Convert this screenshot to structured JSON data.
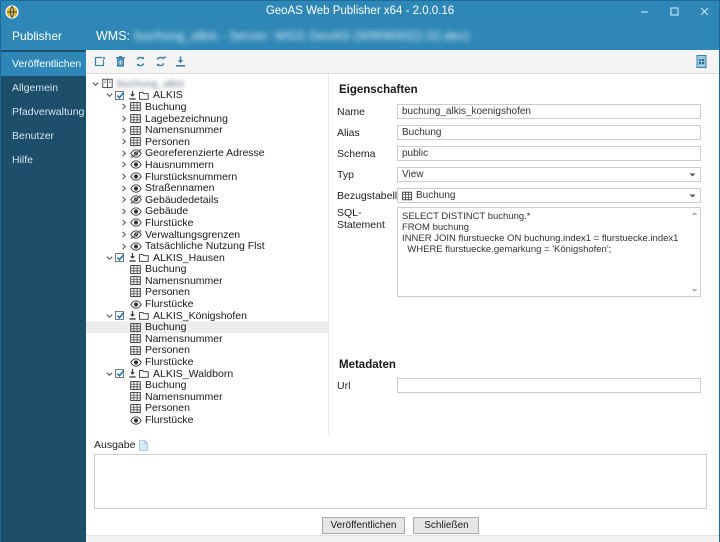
{
  "window": {
    "title": "GeoAS Web Publisher x64 - 2.0.0.16",
    "app_icon": "globe-icon",
    "minimize": "–",
    "maximize": "□",
    "close": "✕"
  },
  "sidebar": {
    "brand": "Publisher",
    "items": [
      {
        "label": "Veröffentlichen",
        "selected": true
      },
      {
        "label": "Allgemein",
        "selected": false
      },
      {
        "label": "Pfadverwaltung",
        "selected": false
      },
      {
        "label": "Benutzer",
        "selected": false
      },
      {
        "label": "Hilfe",
        "selected": false
      }
    ]
  },
  "wms_header": {
    "prefix": "WMS:",
    "value": "buchung_alkis - Server: WGS GeoAS (WWW0022.02.dev)"
  },
  "toolbar": {
    "buttons": [
      {
        "name": "new-icon",
        "title": "Neu"
      },
      {
        "name": "delete-icon",
        "title": "Löschen"
      },
      {
        "name": "refresh-icon",
        "title": "Aktualisieren"
      },
      {
        "name": "refresh-all-icon",
        "title": "Alle aktualisieren"
      },
      {
        "name": "import-icon",
        "title": "Importieren"
      }
    ],
    "right_button": {
      "name": "copy-document-icon",
      "title": "Dokument"
    }
  },
  "tree": {
    "nodes": [
      {
        "depth": 0,
        "label": "buchung_alkis",
        "blur": true,
        "expander": "down",
        "checkbox": false,
        "icon": "book-icon",
        "selected": false
      },
      {
        "depth": 1,
        "label": "ALKIS",
        "blur": false,
        "expander": "down",
        "checkbox": true,
        "icon": "layer-group-icon",
        "selected": false
      },
      {
        "depth": 2,
        "label": "Buchung",
        "blur": false,
        "expander": "right",
        "checkbox": false,
        "icon": "table-icon",
        "selected": false
      },
      {
        "depth": 2,
        "label": "Lagebezeichnung",
        "blur": false,
        "expander": "right",
        "checkbox": false,
        "icon": "table-icon",
        "selected": false
      },
      {
        "depth": 2,
        "label": "Namensnummer",
        "blur": false,
        "expander": "right",
        "checkbox": false,
        "icon": "table-icon",
        "selected": false
      },
      {
        "depth": 2,
        "label": "Personen",
        "blur": false,
        "expander": "right",
        "checkbox": false,
        "icon": "table-icon",
        "selected": false
      },
      {
        "depth": 2,
        "label": "Georeferenzierte Adresse",
        "blur": false,
        "expander": "right",
        "checkbox": false,
        "icon": "eye-off-icon",
        "selected": false
      },
      {
        "depth": 2,
        "label": "Hausnummern",
        "blur": false,
        "expander": "right",
        "checkbox": false,
        "icon": "eye-icon",
        "selected": false
      },
      {
        "depth": 2,
        "label": "Flurstücksnummern",
        "blur": false,
        "expander": "right",
        "checkbox": false,
        "icon": "eye-icon",
        "selected": false
      },
      {
        "depth": 2,
        "label": "Straßennamen",
        "blur": false,
        "expander": "right",
        "checkbox": false,
        "icon": "eye-icon",
        "selected": false
      },
      {
        "depth": 2,
        "label": "Gebäudedetails",
        "blur": false,
        "expander": "right",
        "checkbox": false,
        "icon": "eye-off-icon",
        "selected": false
      },
      {
        "depth": 2,
        "label": "Gebäude",
        "blur": false,
        "expander": "right",
        "checkbox": false,
        "icon": "eye-icon",
        "selected": false
      },
      {
        "depth": 2,
        "label": "Flurstücke",
        "blur": false,
        "expander": "right",
        "checkbox": false,
        "icon": "eye-icon",
        "selected": false
      },
      {
        "depth": 2,
        "label": "Verwaltungsgrenzen",
        "blur": false,
        "expander": "right",
        "checkbox": false,
        "icon": "eye-off-icon",
        "selected": false
      },
      {
        "depth": 2,
        "label": "Tatsächliche Nutzung Flst",
        "blur": false,
        "expander": "right",
        "checkbox": false,
        "icon": "eye-icon",
        "selected": false
      },
      {
        "depth": 1,
        "label": "ALKIS_Hausen",
        "blur": false,
        "expander": "down",
        "checkbox": true,
        "icon": "layer-group-icon",
        "selected": false
      },
      {
        "depth": 2,
        "label": "Buchung",
        "blur": false,
        "expander": "none",
        "checkbox": false,
        "icon": "table-icon",
        "selected": false
      },
      {
        "depth": 2,
        "label": "Namensnummer",
        "blur": false,
        "expander": "none",
        "checkbox": false,
        "icon": "table-icon",
        "selected": false
      },
      {
        "depth": 2,
        "label": "Personen",
        "blur": false,
        "expander": "none",
        "checkbox": false,
        "icon": "table-icon",
        "selected": false
      },
      {
        "depth": 2,
        "label": "Flurstücke",
        "blur": false,
        "expander": "none",
        "checkbox": false,
        "icon": "eye-icon",
        "selected": false
      },
      {
        "depth": 1,
        "label": "ALKIS_Königshofen",
        "blur": false,
        "expander": "down",
        "checkbox": true,
        "icon": "layer-group-icon",
        "selected": false
      },
      {
        "depth": 2,
        "label": "Buchung",
        "blur": false,
        "expander": "none",
        "checkbox": false,
        "icon": "table-icon",
        "selected": true
      },
      {
        "depth": 2,
        "label": "Namensnummer",
        "blur": false,
        "expander": "none",
        "checkbox": false,
        "icon": "table-icon",
        "selected": false
      },
      {
        "depth": 2,
        "label": "Personen",
        "blur": false,
        "expander": "none",
        "checkbox": false,
        "icon": "table-icon",
        "selected": false
      },
      {
        "depth": 2,
        "label": "Flurstücke",
        "blur": false,
        "expander": "none",
        "checkbox": false,
        "icon": "eye-icon",
        "selected": false
      },
      {
        "depth": 1,
        "label": "ALKIS_Waldborn",
        "blur": false,
        "expander": "down",
        "checkbox": true,
        "icon": "layer-group-icon",
        "selected": false
      },
      {
        "depth": 2,
        "label": "Buchung",
        "blur": false,
        "expander": "none",
        "checkbox": false,
        "icon": "table-icon",
        "selected": false
      },
      {
        "depth": 2,
        "label": "Namensnummer",
        "blur": false,
        "expander": "none",
        "checkbox": false,
        "icon": "table-icon",
        "selected": false
      },
      {
        "depth": 2,
        "label": "Personen",
        "blur": false,
        "expander": "none",
        "checkbox": false,
        "icon": "table-icon",
        "selected": false
      },
      {
        "depth": 2,
        "label": "Flurstücke",
        "blur": false,
        "expander": "none",
        "checkbox": false,
        "icon": "eye-icon",
        "selected": false
      }
    ]
  },
  "properties": {
    "title": "Eigenschaften",
    "name": {
      "label": "Name",
      "value": "buchung_alkis_koenigshofen"
    },
    "alias": {
      "label": "Alias",
      "value": "Buchung"
    },
    "schema": {
      "label": "Schema",
      "value": "public"
    },
    "typ": {
      "label": "Typ",
      "value": "View"
    },
    "bezugstabelle": {
      "label": "Bezugstabelle",
      "value": "Buchung",
      "icon": "table-icon"
    },
    "sql": {
      "label": "SQL-Statement",
      "value": "SELECT DISTINCT buchung.*\nFROM buchung\nINNER JOIN flurstuecke ON buchung.index1 = flurstuecke.index1\n  WHERE flurstuecke.gemarkung = 'Königshofen';"
    }
  },
  "metadata": {
    "title": "Metadaten",
    "url": {
      "label": "Url",
      "value": ""
    }
  },
  "output": {
    "label": "Ausgabe",
    "icon": "document-icon",
    "text": ""
  },
  "footer": {
    "publish_label": "Veröffentlichen",
    "close_label": "Schließen"
  },
  "colors": {
    "accent": "#2e87b6",
    "sidebar": "#1d4f6b",
    "selection": "#ededed",
    "icon_blue": "#3a7fa8"
  }
}
